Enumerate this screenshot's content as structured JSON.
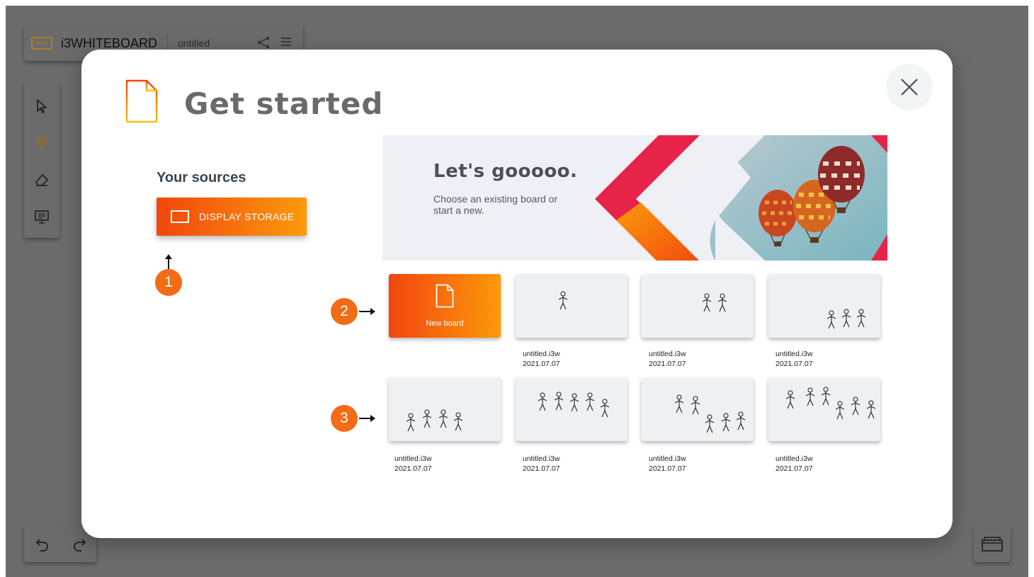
{
  "app": {
    "brand": "i3WHITEBOARD",
    "document_name": "untitled"
  },
  "toolbar": {
    "tools": [
      "select-icon",
      "pen-icon",
      "eraser-icon",
      "present-icon"
    ]
  },
  "modal": {
    "title": "Get started",
    "sources_label": "Your sources",
    "display_storage_label": "DISPLAY STORAGE",
    "banner": {
      "title": "Let's gooooo.",
      "subtitle": "Choose an existing board or start a new."
    },
    "new_board_label": "New board",
    "callouts": [
      "1",
      "2",
      "3"
    ],
    "boards": [
      {
        "name": "untitled.i3w",
        "date": "2021.07.07",
        "figures": 1
      },
      {
        "name": "untitled.i3w",
        "date": "2021.07.07",
        "figures": 2
      },
      {
        "name": "untitled.i3w",
        "date": "2021.07.07",
        "figures": 3
      },
      {
        "name": "untitled.i3w",
        "date": "2021.07.07",
        "figures": 4
      },
      {
        "name": "untitled.i3w",
        "date": "2021.07.07",
        "figures": 5
      },
      {
        "name": "untitled.i3w",
        "date": "2021.07.07",
        "figures": 5
      },
      {
        "name": "untitled.i3w",
        "date": "2021.07.07",
        "figures": 6
      }
    ]
  },
  "colors": {
    "accent_start": "#f2460e",
    "accent_end": "#fb9a0a",
    "callout": "#f26b15",
    "backdrop": "#6c6c6c"
  }
}
